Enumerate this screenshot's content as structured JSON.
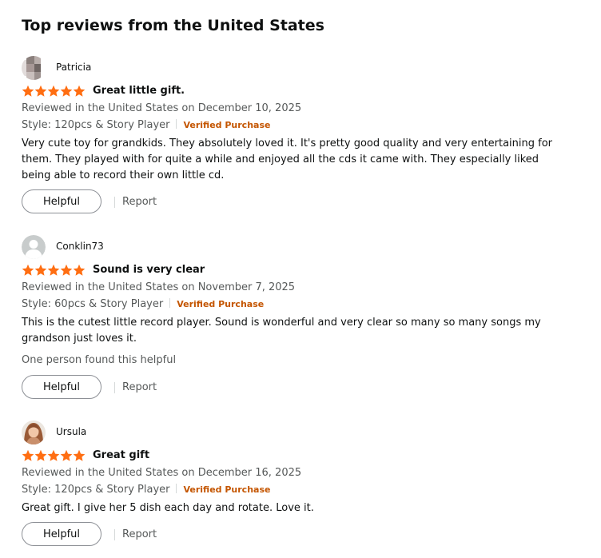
{
  "section": {
    "title": "Top reviews from the United States"
  },
  "reviews": [
    {
      "profile_name": "Patricia",
      "rating": 5,
      "title": "Great little gift.",
      "date_line": "Reviewed in the United States on December 10, 2025",
      "style": "Style: 120pcs & Story Player",
      "verified": "Verified Purchase",
      "body": "Very cute toy for grandkids. They absolutely loved it. It's pretty good quality and very entertaining for them. They played with for quite a while and enjoyed all the cds it came with. They especially liked being able to record their own little cd.",
      "helpful_label": "Helpful",
      "report_label": "Report"
    },
    {
      "profile_name": "Conklin73",
      "rating": 5,
      "title": "Sound is very clear",
      "date_line": "Reviewed in the United States on November 7, 2025",
      "style": "Style: 60pcs & Story Player",
      "verified": "Verified Purchase",
      "body": "This is the cutest little record player. Sound is wonderful and very clear so many so many songs my grandson just loves it.",
      "helpful_count": "One person found this helpful",
      "helpful_label": "Helpful",
      "report_label": "Report"
    },
    {
      "profile_name": "Ursula",
      "rating": 5,
      "title": "Great gift",
      "date_line": "Reviewed in the United States on December 16, 2025",
      "style": "Style: 120pcs & Story Player",
      "verified": "Verified Purchase",
      "body": "Great gift. I give her 5 dish each day and rotate. Love it.",
      "helpful_label": "Helpful",
      "report_label": "Report"
    }
  ],
  "colors": {
    "star": "#ff6e12",
    "verified": "#c45500",
    "secondary_text": "#565959",
    "primary_text": "#0f1111"
  },
  "icons": {
    "star": "star-icon",
    "avatar_default": "default-avatar-icon"
  }
}
